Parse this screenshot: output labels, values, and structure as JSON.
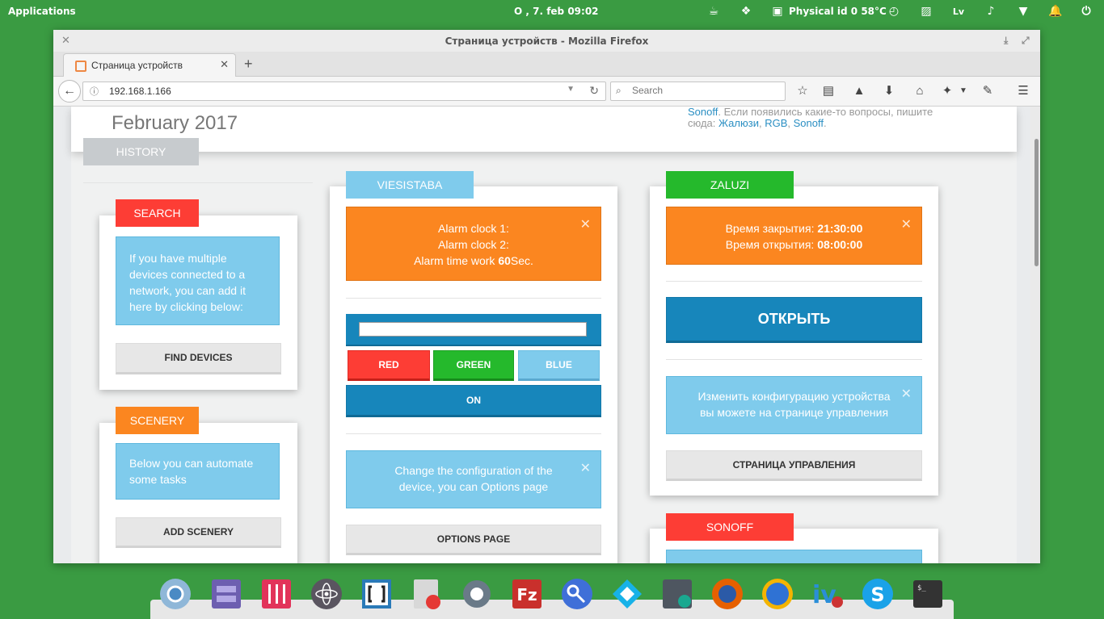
{
  "topbar": {
    "apps": "Applications",
    "clock": "О , 7. feb   09:02",
    "sensor": "Physical id 0 58°C",
    "lang": "Lv"
  },
  "window": {
    "title": "Страница устройств - Mozilla Firefox",
    "tab_label": "Страница устройств",
    "url": "192.168.1.166",
    "search_placeholder": "Search"
  },
  "page": {
    "date": "February 2017",
    "history_tab": "HISTORY",
    "topnote": {
      "lead_link": "Sonoff",
      "line1": ". Если появились какие-то вопросы, пишите",
      "line2": "сюда: ",
      "link1": "Жалюзи",
      "sep1": ", ",
      "link2": "RGB",
      "sep2": ", ",
      "link3": "Sonoff",
      "end": "."
    },
    "search_card": {
      "ribbon": "SEARCH",
      "text": "If you have multiple devices connected to a network, you can add it here by clicking below:",
      "button": "FIND DEVICES"
    },
    "scenery_card": {
      "ribbon": "SCENERY",
      "text": "Below you can automate some tasks",
      "button": "ADD SCENERY"
    },
    "viesistaba": {
      "ribbon": "VIESISTABA",
      "alarm1": "Alarm clock 1:",
      "alarm2": "Alarm clock 2:",
      "alarm_work_prefix": "Alarm time work ",
      "alarm_work_value": "60",
      "alarm_work_suffix": "Sec.",
      "btn_red": "RED",
      "btn_green": "GREEN",
      "btn_blue": "BLUE",
      "btn_on": "ON",
      "info": "Change the configuration of the device, you can Options page",
      "btn_options": "OPTIONS PAGE"
    },
    "zaluzi": {
      "ribbon": "ZALUZI",
      "close_label": "Время закрытия: ",
      "close_time": "21:30:00",
      "open_label": "Время открытия: ",
      "open_time": "08:00:00",
      "btn_open": "ОТКРЫТЬ",
      "info": "Изменить конфигурацию устройства вы можете на странице управления",
      "btn_manage": "СТРАНИЦА УПРАВЛЕНИЯ"
    },
    "sonoff": {
      "ribbon": "SONOFF"
    }
  },
  "colors": {
    "red": "#fd3d35",
    "orange": "#fb8620",
    "green": "#25b92c",
    "lightblue": "#7fcbec",
    "blue": "#1786bb",
    "gray": "#c7cbce"
  }
}
